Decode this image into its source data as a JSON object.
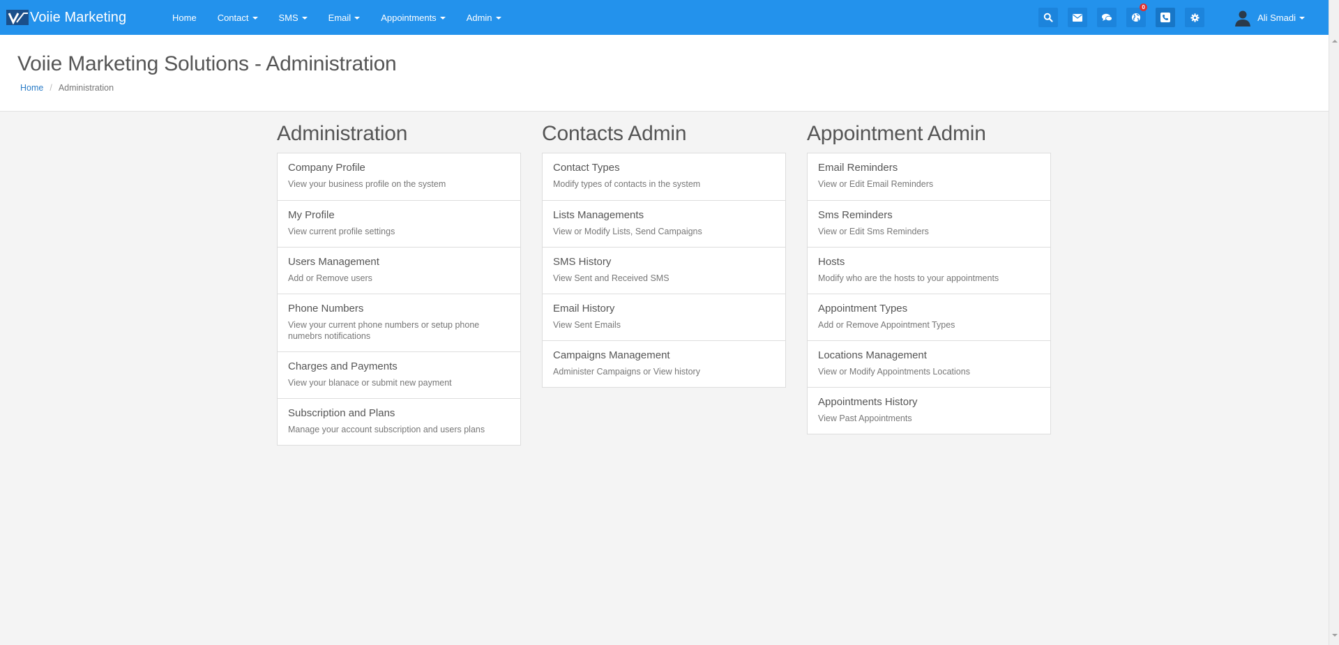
{
  "navbar": {
    "brand": "Voiie Marketing",
    "menu": [
      {
        "label": "Home",
        "dropdown": false
      },
      {
        "label": "Contact",
        "dropdown": true
      },
      {
        "label": "SMS",
        "dropdown": true
      },
      {
        "label": "Email",
        "dropdown": true
      },
      {
        "label": "Appointments",
        "dropdown": true
      },
      {
        "label": "Admin",
        "dropdown": true
      }
    ],
    "icons": [
      "search-icon",
      "envelope-icon",
      "comments-icon",
      "globe-icon",
      "phone-icon",
      "gear-icon"
    ],
    "notification_count": "0",
    "user_name": "Ali Smadi",
    "accent_color": "#2392ec"
  },
  "header": {
    "title": "Voiie Marketing Solutions - Administration",
    "breadcrumb": {
      "home": "Home",
      "separator": "/",
      "current": "Administration"
    }
  },
  "columns": [
    {
      "title": "Administration",
      "items": [
        {
          "title": "Company Profile",
          "desc": "View your business profile on the system"
        },
        {
          "title": "My Profile",
          "desc": "View current profile settings"
        },
        {
          "title": "Users Management",
          "desc": "Add or Remove users"
        },
        {
          "title": "Phone Numbers",
          "desc": "View your current phone numbers or setup phone numebrs notifications"
        },
        {
          "title": "Charges and Payments",
          "desc": "View your blanace or submit new payment"
        },
        {
          "title": "Subscription and Plans",
          "desc": "Manage your account subscription and users plans"
        }
      ]
    },
    {
      "title": "Contacts Admin",
      "items": [
        {
          "title": "Contact Types",
          "desc": "Modify types of contacts in the system"
        },
        {
          "title": "Lists Managements",
          "desc": "View or Modify Lists, Send Campaigns"
        },
        {
          "title": "SMS History",
          "desc": "View Sent and Received SMS"
        },
        {
          "title": "Email History",
          "desc": "View Sent Emails"
        },
        {
          "title": "Campaigns Management",
          "desc": "Administer Campaigns or View history"
        }
      ]
    },
    {
      "title": "Appointment Admin",
      "items": [
        {
          "title": "Email Reminders",
          "desc": "View or Edit Email Reminders"
        },
        {
          "title": "Sms Reminders",
          "desc": "View or Edit Sms Reminders"
        },
        {
          "title": "Hosts",
          "desc": "Modify who are the hosts to your appointments"
        },
        {
          "title": "Appointment Types",
          "desc": "Add or Remove Appointment Types"
        },
        {
          "title": "Locations Management",
          "desc": "View or Modify Appointments Locations"
        },
        {
          "title": "Appointments History",
          "desc": "View Past Appointments"
        }
      ]
    }
  ]
}
